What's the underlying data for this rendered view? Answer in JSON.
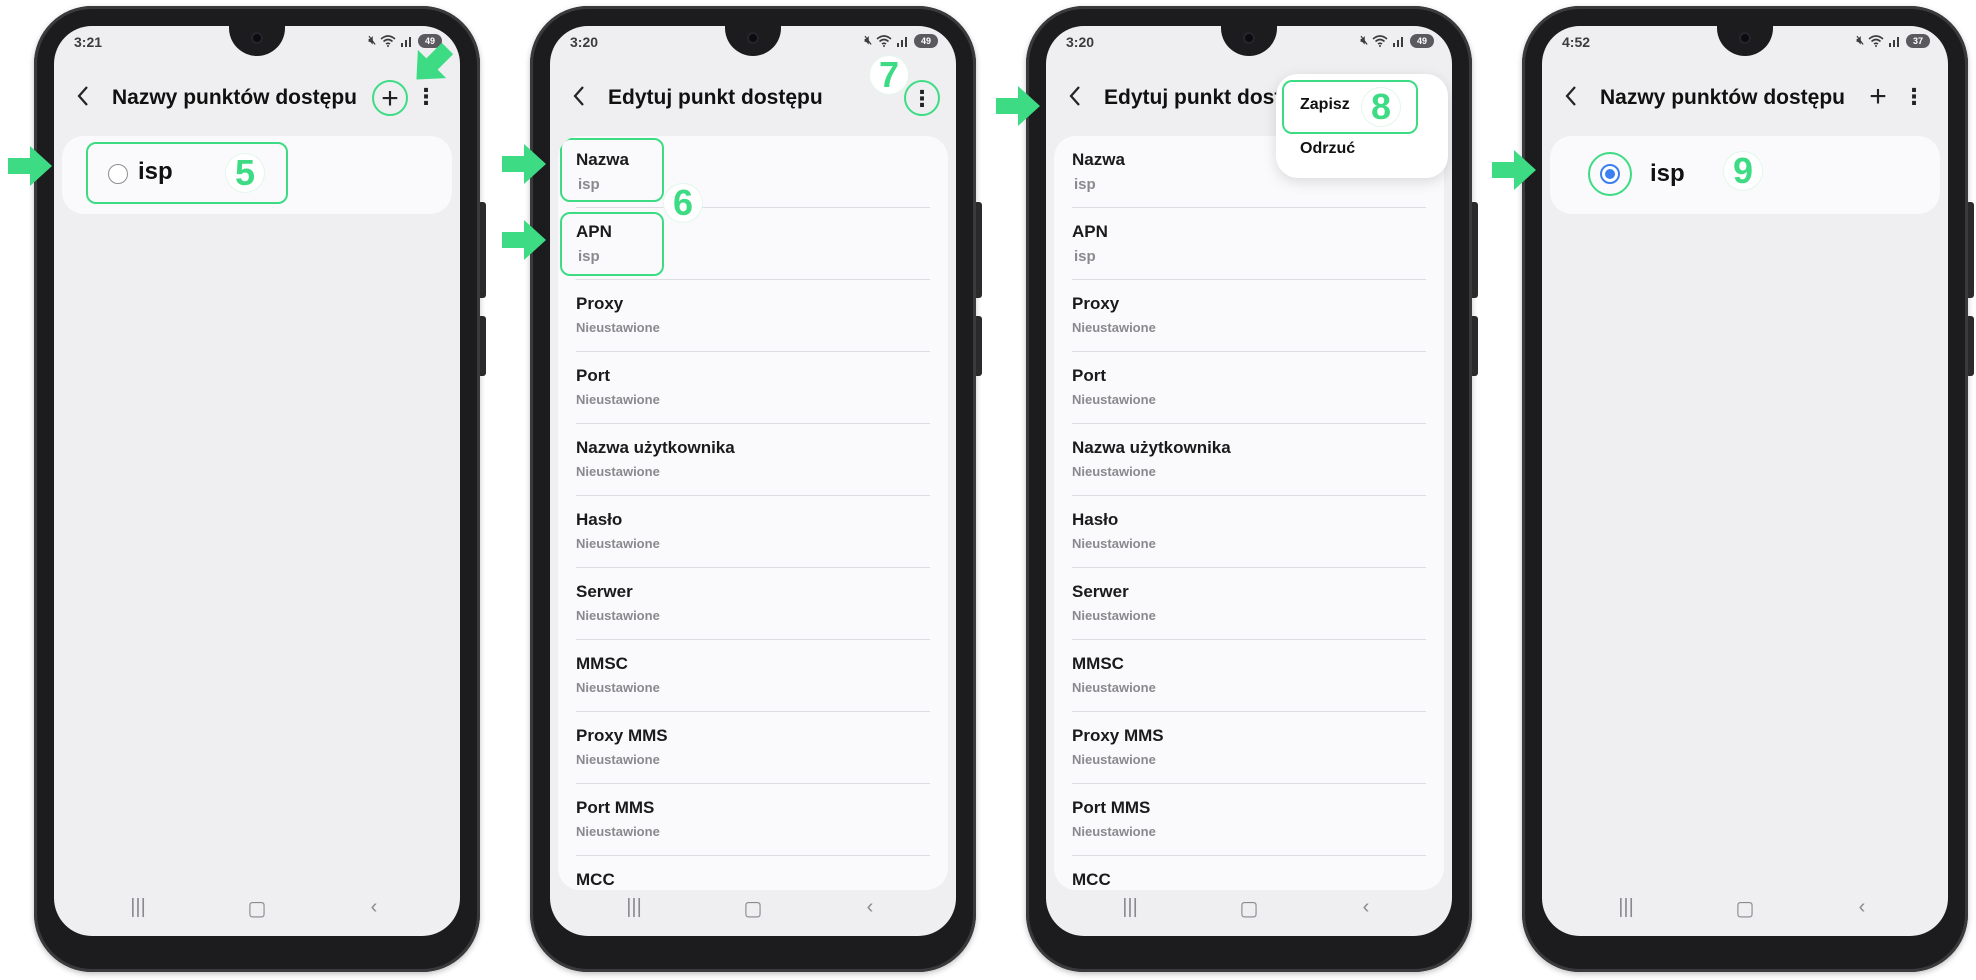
{
  "colors": {
    "accent_green": "#3ddc84",
    "radio_blue": "#3b7ff0",
    "screen_bg": "#efeff1",
    "phone_body": "#1c1c1e"
  },
  "phones": [
    {
      "status": {
        "time": "3:21",
        "battery": "49"
      },
      "title": "Nazwy punktów dostępu",
      "apn_item": {
        "label": "isp",
        "selected": false
      },
      "step": "5"
    },
    {
      "status": {
        "time": "3:20",
        "battery": "49"
      },
      "title": "Edytuj punkt dostępu",
      "steps": [
        "6",
        "7"
      ],
      "fields": [
        {
          "label": "Nazwa",
          "value": "isp"
        },
        {
          "label": "APN",
          "value": "isp"
        },
        {
          "label": "Proxy",
          "value": "Nieustawione"
        },
        {
          "label": "Port",
          "value": "Nieustawione"
        },
        {
          "label": "Nazwa użytkownika",
          "value": "Nieustawione"
        },
        {
          "label": "Hasło",
          "value": "Nieustawione"
        },
        {
          "label": "Serwer",
          "value": "Nieustawione"
        },
        {
          "label": "MMSC",
          "value": "Nieustawione"
        },
        {
          "label": "Proxy MMS",
          "value": "Nieustawione"
        },
        {
          "label": "Port MMS",
          "value": "Nieustawione"
        },
        {
          "label": "MCC",
          "value": ""
        }
      ]
    },
    {
      "status": {
        "time": "3:20",
        "battery": "49"
      },
      "title": "Edytuj punkt dost",
      "menu": {
        "save": "Zapisz",
        "discard": "Odrzuć"
      },
      "step": "8"
    },
    {
      "status": {
        "time": "4:52",
        "battery": "37"
      },
      "title": "Nazwy punktów dostępu",
      "apn_item": {
        "label": "isp",
        "selected": true
      },
      "step": "9"
    }
  ],
  "icons": {
    "back": "chevron-left-icon",
    "add": "plus-icon",
    "more": "more-vertical-icon",
    "mute": "mute-icon",
    "wifi": "wifi-icon",
    "signal": "signal-icon",
    "battery": "battery-icon",
    "nav_recents": "recents-icon",
    "nav_home": "home-icon",
    "nav_back": "nav-back-icon",
    "pointer": "green-arrow-icon"
  }
}
